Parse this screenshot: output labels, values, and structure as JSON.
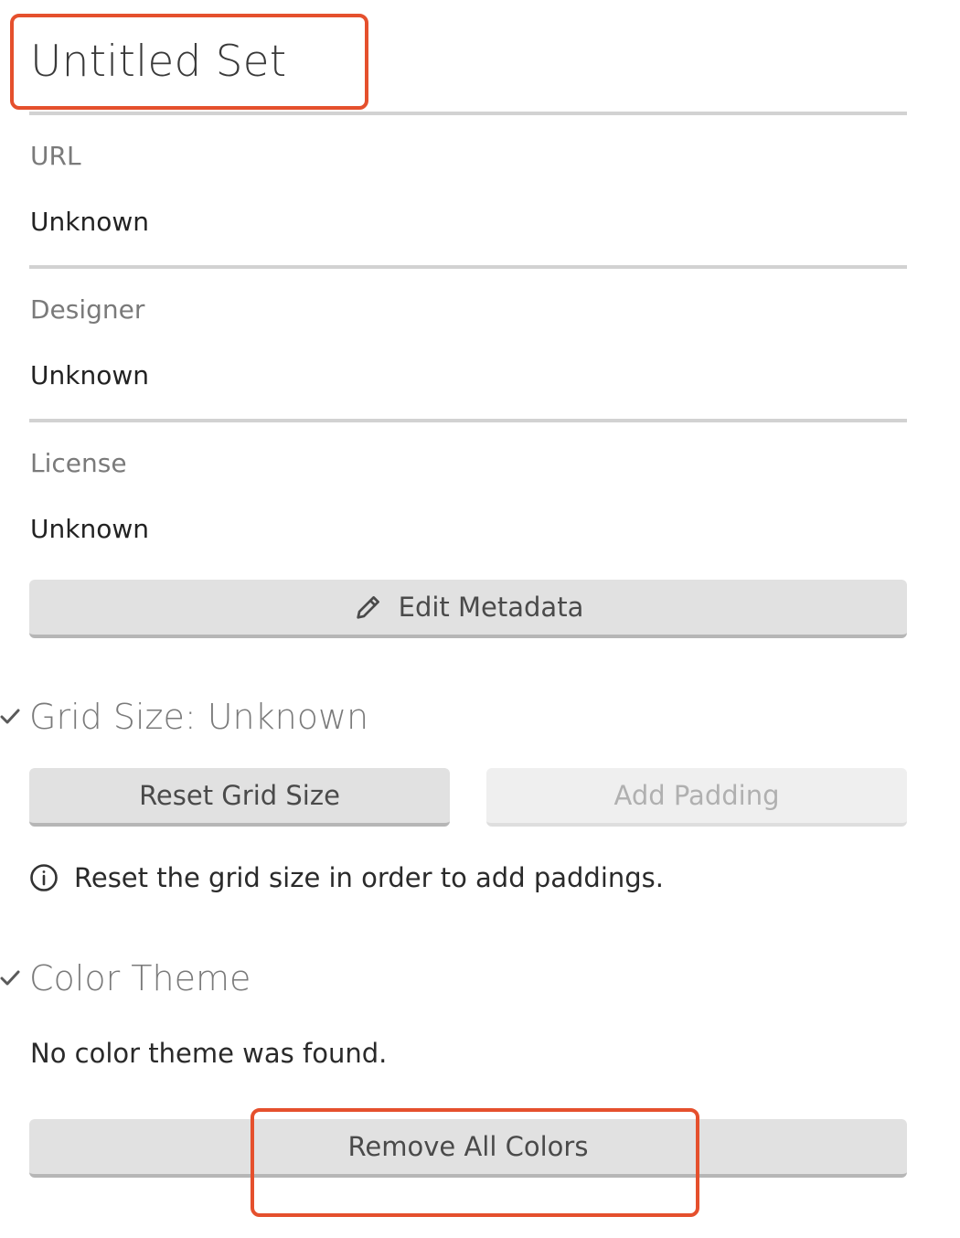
{
  "set": {
    "title": "Untitled Set"
  },
  "metadata": {
    "fields": [
      {
        "label": "URL",
        "value": "Unknown"
      },
      {
        "label": "Designer",
        "value": "Unknown"
      },
      {
        "label": "License",
        "value": "Unknown"
      }
    ],
    "edit_button": {
      "label": "Edit Metadata",
      "icon": "pencil-icon"
    }
  },
  "grid": {
    "title": "Grid Size: Unknown",
    "reset_button": "Reset Grid Size",
    "padding_button": "Add Padding",
    "info_text": "Reset the grid size in order to add paddings.",
    "info_icon": "info-circle-icon"
  },
  "color_theme": {
    "title": "Color Theme",
    "message": "No color theme was found.",
    "remove_button": "Remove All Colors"
  },
  "colors": {
    "highlight": "#e5502d",
    "button_bg": "#e1e1e1",
    "separator": "#d2d2d2"
  }
}
